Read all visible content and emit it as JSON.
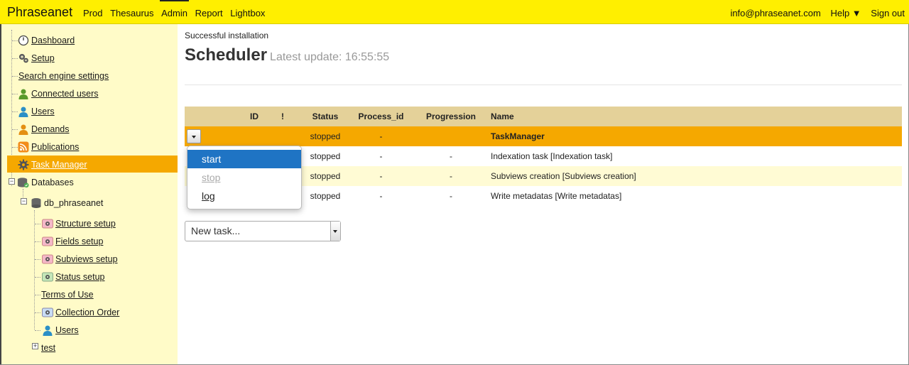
{
  "topbar": {
    "brand": "Phraseanet",
    "nav": [
      "Prod",
      "Thesaurus",
      "Admin",
      "Report",
      "Lightbox"
    ],
    "active": "Admin",
    "user_email": "info@phraseanet.com",
    "help": "Help ▼",
    "signout": "Sign out",
    "accent": "#ffef00"
  },
  "sidebar": {
    "items": [
      {
        "label": "Dashboard",
        "icon": "dashboard-icon"
      },
      {
        "label": "Setup",
        "icon": "gears-icon"
      },
      {
        "label": "Search engine settings",
        "icon": ""
      },
      {
        "label": "Connected users",
        "icon": "user-green-icon"
      },
      {
        "label": "Users",
        "icon": "user-blue-icon"
      },
      {
        "label": "Demands",
        "icon": "user-orange-icon"
      },
      {
        "label": "Publications",
        "icon": "rss-icon"
      },
      {
        "label": "Task Manager",
        "icon": "gear-icon",
        "selected": true
      },
      {
        "label": "Databases",
        "icon": "databases-icon"
      }
    ],
    "database": {
      "label": "db_phraseanet",
      "children": [
        {
          "label": "Structure setup",
          "icon": "collection-red-icon"
        },
        {
          "label": "Fields setup",
          "icon": "collection-red-icon"
        },
        {
          "label": "Subviews setup",
          "icon": "collection-red-icon"
        },
        {
          "label": "Status setup",
          "icon": "collection-green-icon"
        },
        {
          "label": "Terms of Use",
          "icon": ""
        },
        {
          "label": "Collection Order",
          "icon": "collection-blue-icon"
        },
        {
          "label": "Users",
          "icon": "user-blue-icon"
        }
      ]
    },
    "other_db": "test",
    "highlight_color": "#f5a800"
  },
  "main": {
    "success": "Successful installation",
    "title": "Scheduler",
    "last_update": "Latest update: 16:55:55",
    "columns": [
      "",
      "ID",
      "!",
      "Status",
      "Process_id",
      "Progression",
      "Name"
    ],
    "rows": [
      {
        "id": "",
        "warn": "",
        "status": "stopped",
        "pid": "-",
        "progress": "",
        "name": "TaskManager"
      },
      {
        "id": "",
        "warn": "",
        "status": "stopped",
        "pid": "-",
        "progress": "-",
        "name": "Indexation task [Indexation task]"
      },
      {
        "id": "",
        "warn": "",
        "status": "stopped",
        "pid": "-",
        "progress": "-",
        "name": "Subviews creation [Subviews creation]"
      },
      {
        "id": "",
        "warn": "",
        "status": "stopped",
        "pid": "-",
        "progress": "-",
        "name": "Write metadatas [Write metadatas]"
      }
    ],
    "menu": {
      "start": "start",
      "stop": "stop",
      "log": "log"
    },
    "new_task": "New task...",
    "header_color": "#e4d199",
    "menu_active_color": "#1f74c4"
  }
}
